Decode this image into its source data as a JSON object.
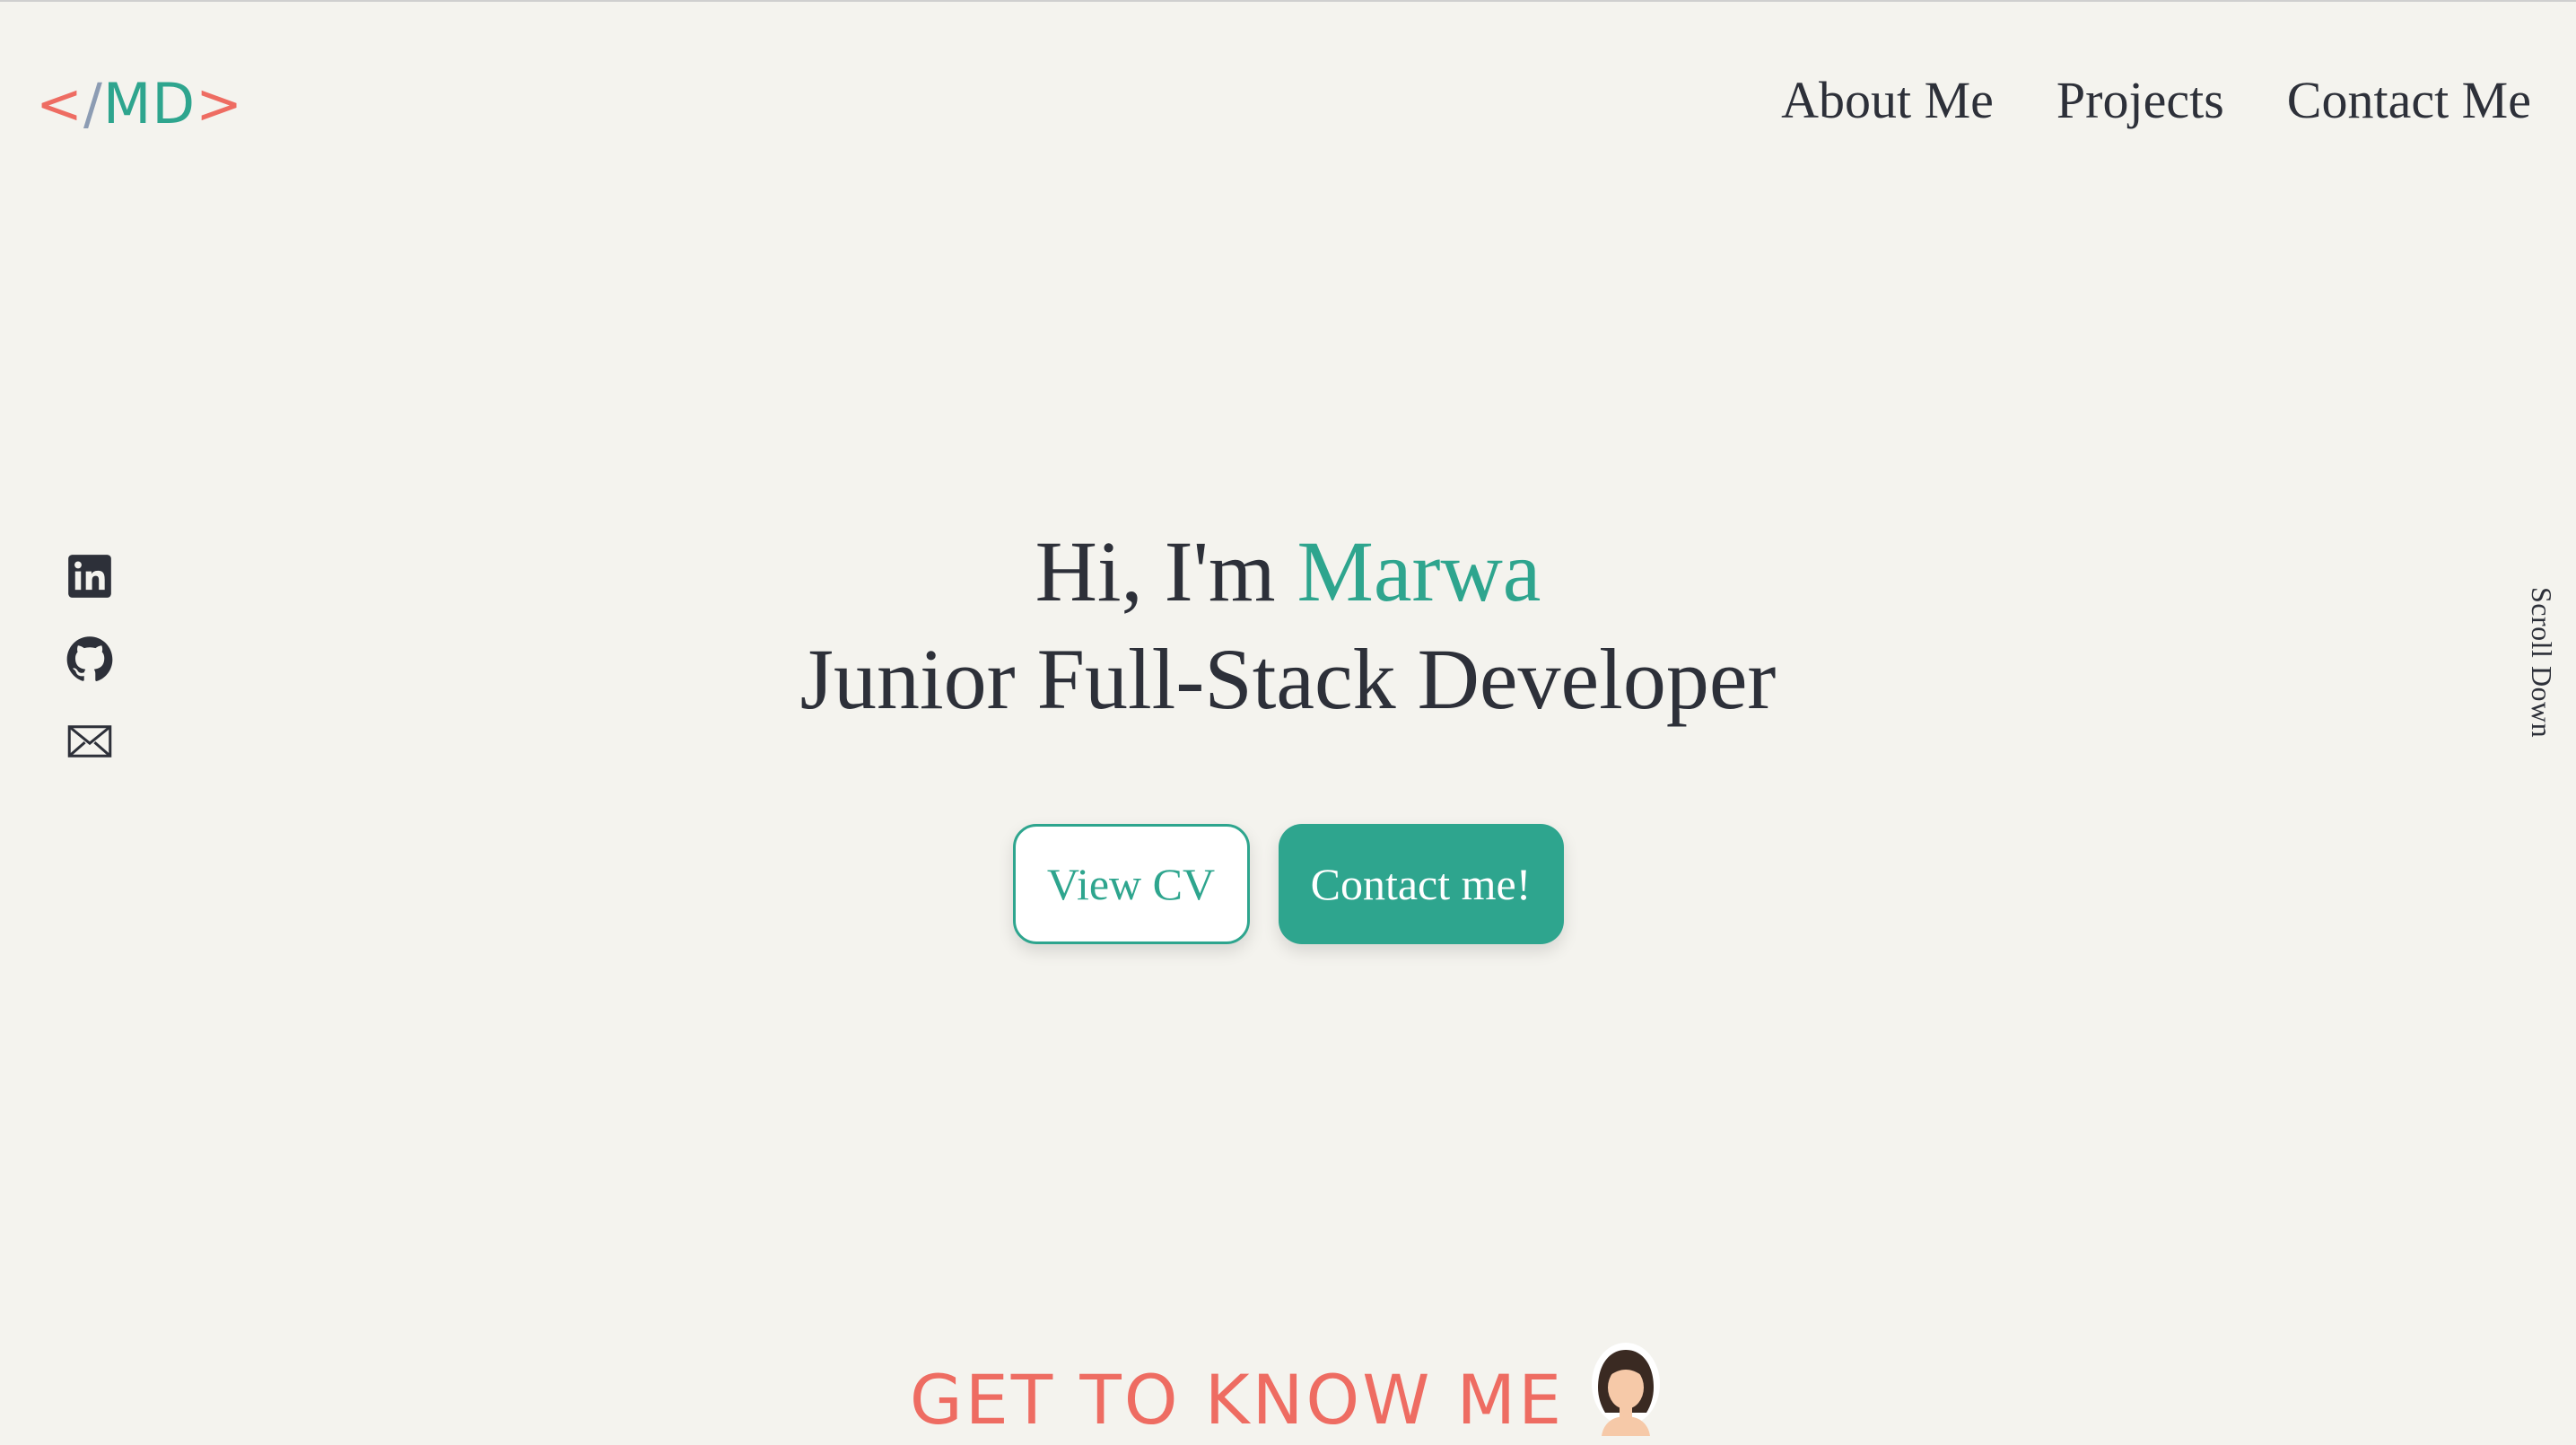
{
  "logo": {
    "open": "<",
    "slash": "/",
    "initials": "MD",
    "close": ">"
  },
  "nav": {
    "items": [
      "About Me",
      "Projects",
      "Contact Me"
    ]
  },
  "social": {
    "icons": [
      "linkedin-icon",
      "github-icon",
      "mail-icon"
    ]
  },
  "hero": {
    "greeting": "Hi, I'm",
    "name": "Marwa",
    "role": "Junior Full-Stack Developer"
  },
  "buttons": {
    "view_cv": "View CV",
    "contact": "Contact me!"
  },
  "scroll_down": "Scroll Down",
  "section": {
    "title": "GET TO KNOW ME"
  },
  "colors": {
    "background": "#f4f3ee",
    "accent_teal": "#2ea58e",
    "accent_coral": "#ee6c62",
    "text_dark": "#2d3039"
  }
}
